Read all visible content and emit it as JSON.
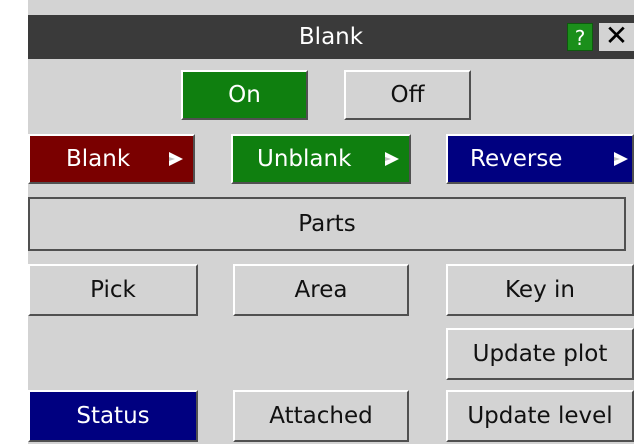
{
  "window": {
    "title": "Blank",
    "help_label": "?",
    "close_label": "✕"
  },
  "toggle": {
    "on_label": "On",
    "off_label": "Off"
  },
  "modes": {
    "blank_label": "Blank",
    "unblank_label": "Unblank",
    "reverse_label": "Reverse"
  },
  "entity": {
    "type_label": "Parts"
  },
  "select": {
    "pick_label": "Pick",
    "area_label": "Area",
    "keyin_label": "Key in"
  },
  "actions": {
    "update_plot_label": "Update plot",
    "update_level_label": "Update level",
    "status_label": "Status",
    "attached_label": "Attached"
  },
  "colors": {
    "active_green": "#0f7f0f",
    "blank_red": "#7a0000",
    "reverse_navy": "#000080",
    "title_bg": "#3a3a3a",
    "panel_bg": "#d3d3d3"
  }
}
